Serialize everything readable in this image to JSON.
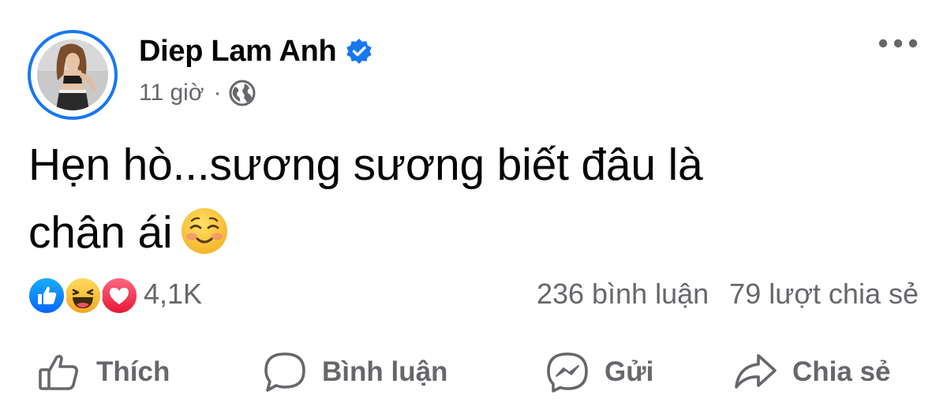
{
  "post": {
    "author": "Diep Lam Anh",
    "verified": true,
    "time": "11 giờ",
    "separator": "·",
    "audience_icon": "globe-icon",
    "message_line1": "Hẹn hò...sương sương biết đâu là",
    "message_line2": "chân ái",
    "message_emoji": "smiling-face-emoji"
  },
  "reactions": {
    "icons": [
      "like-reaction-icon",
      "haha-reaction-icon",
      "love-reaction-icon"
    ],
    "count": "4,1K"
  },
  "stats": {
    "comments": "236 bình luận",
    "shares": "79 lượt chia sẻ"
  },
  "actions": {
    "like": "Thích",
    "comment": "Bình luận",
    "send": "Gửi",
    "share": "Chia sẻ"
  },
  "colors": {
    "accent": "#1877f2",
    "secondary_text": "#65676b",
    "primary_text": "#050505",
    "love": "#f33e58",
    "haha": "#f7b125"
  }
}
